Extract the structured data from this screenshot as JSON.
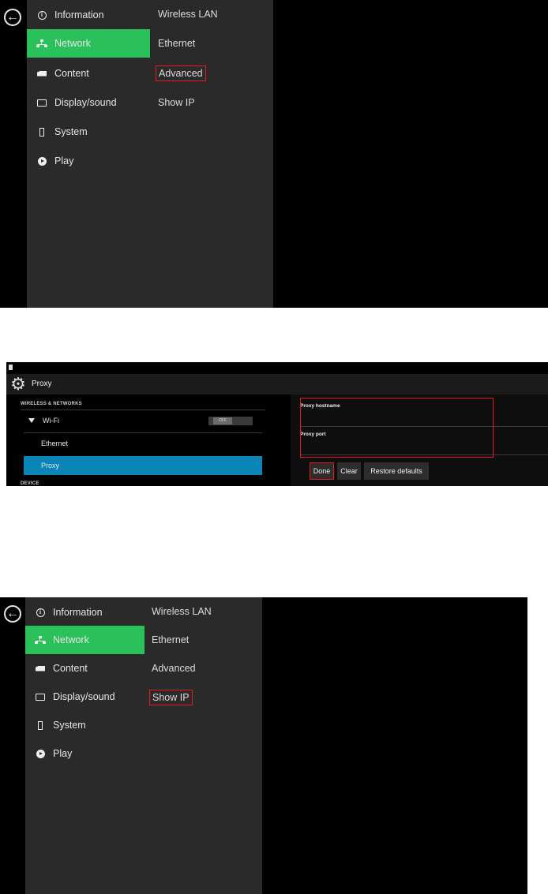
{
  "menu": {
    "items": [
      {
        "label": "Information",
        "icon": "info-icon"
      },
      {
        "label": "Network",
        "icon": "network-icon"
      },
      {
        "label": "Content",
        "icon": "content-icon"
      },
      {
        "label": "Display/sound",
        "icon": "display-icon"
      },
      {
        "label": "System",
        "icon": "system-icon"
      },
      {
        "label": "Play",
        "icon": "play-icon"
      }
    ],
    "active_color": "#2bc15a"
  },
  "network_submenu": {
    "items": [
      {
        "label": "Wireless LAN"
      },
      {
        "label": "Ethernet"
      },
      {
        "label": "Advanced"
      },
      {
        "label": "Show IP"
      }
    ]
  },
  "proxy_screen": {
    "title": "Proxy",
    "section_wireless": "WIRELESS & NETWORKS",
    "wifi_label": "Wi-Fi",
    "wifi_toggle": "OFF",
    "ethernet_label": "Ethernet",
    "proxy_label": "Proxy",
    "section_device": "DEVICE",
    "proxy_hostname_label": "Proxy hostname",
    "proxy_port_label": "Proxy port",
    "done_label": "Done",
    "clear_label": "Clear",
    "restore_label": "Restore defaults",
    "selected_color": "#0b84b8"
  },
  "highlight_color": "#e01b24"
}
